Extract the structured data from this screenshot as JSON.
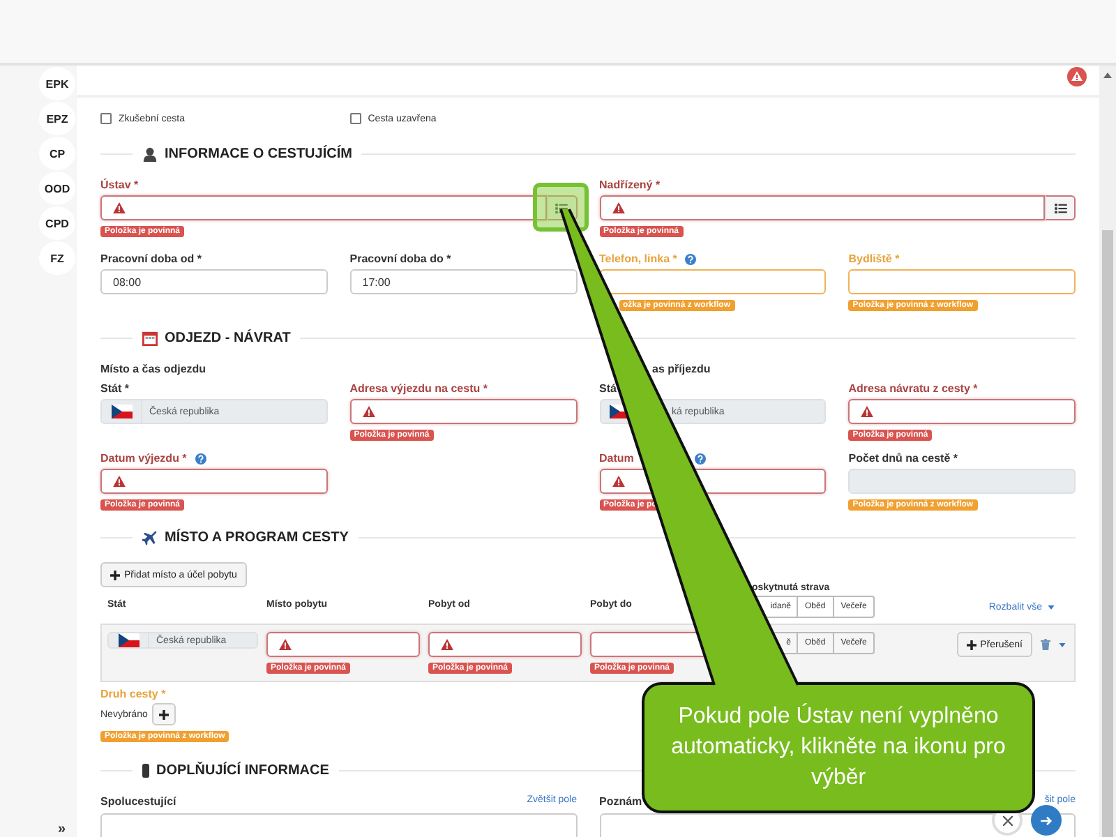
{
  "sidebar": {
    "items": [
      {
        "label": "EPK"
      },
      {
        "label": "EPZ"
      },
      {
        "label": "CP"
      },
      {
        "label": "OOD"
      },
      {
        "label": "CPD"
      },
      {
        "label": "FZ"
      }
    ],
    "collapse": "»"
  },
  "header": {
    "alert": true
  },
  "checkboxes": [
    {
      "label": "Zkušební cesta",
      "checked": false
    },
    {
      "label": "Cesta uzavřena",
      "checked": false
    }
  ],
  "traveler": {
    "title": "INFORMACE O CESTUJÍCÍM",
    "cells": [
      {
        "kind": "field",
        "label": "Ústav *",
        "invalid": true,
        "picker": true,
        "highlighted": true,
        "error": {
          "text": "Položka je povinná",
          "workflow": false
        }
      },
      {
        "kind": "field",
        "label": "Nadřízený *",
        "invalid": true,
        "picker": true,
        "highlighted": false,
        "error": {
          "text": "Položka je povinná",
          "workflow": false
        }
      },
      {
        "kind": "field",
        "label": "Pracovní doba od *",
        "value": "08:00"
      },
      {
        "kind": "field",
        "label": "Pracovní doba do *",
        "value": "17:00"
      },
      {
        "kind": "field",
        "label": "Telefon, linka *",
        "warning": true,
        "help": true,
        "error": {
          "text": "ožka je povinná z workflow",
          "workflow": true,
          "cut": true
        }
      },
      {
        "kind": "field",
        "label": "Bydliště *",
        "warning": true,
        "error": {
          "text": "Položka je povinná z workflow",
          "workflow": true
        }
      }
    ]
  },
  "departure": {
    "title": "ODJEZD - NÁVRAT",
    "cells": [
      {
        "kind": "heading",
        "label": "Místo a čas odjezdu"
      },
      {
        "kind": "heading",
        "label": "as příjezdu",
        "cut": true
      },
      {
        "kind": "country",
        "label": "Stát *",
        "value": "Česká republika"
      },
      {
        "kind": "field",
        "label": "Adresa výjezdu na cestu *",
        "invalid": true,
        "error": {
          "text": "Položka je povinná",
          "workflow": false
        }
      },
      {
        "kind": "country",
        "label": "Stá",
        "value": "ká republika",
        "cut": true
      },
      {
        "kind": "field",
        "label": "Adresa návratu z cesty *",
        "invalid": true,
        "error": {
          "text": "Položka je povinná",
          "workflow": false
        }
      },
      {
        "kind": "field",
        "label": "Datum výjezdu *",
        "invalid": true,
        "help": true,
        "error": {
          "text": "Položka je povinná",
          "workflow": false
        }
      },
      {
        "kind": "empty"
      },
      {
        "kind": "field",
        "label": "Datum",
        "invalid": true,
        "help": true,
        "help_cut": true,
        "error": {
          "text": "Položka je po",
          "workflow": false
        }
      },
      {
        "kind": "field",
        "label": "Počet dnů na cestě *",
        "readonly": true,
        "error": {
          "text": "Položka je povinná z workflow",
          "workflow": true
        }
      }
    ]
  },
  "program": {
    "title": "MÍSTO A PROGRAM CESTY",
    "add_button": "Přidat místo a účel pobytu",
    "columns": [
      "Stát",
      "Místo pobytu",
      "Pobyt od",
      "Pobyt do"
    ],
    "meals_label": "oskytnutá strava",
    "meals_header": [
      "idaně",
      "Oběd",
      "Večeře"
    ],
    "expand": "Rozbalit vše",
    "rows": [
      {
        "country": "Česká republika",
        "fields": [
          {
            "error": "Položka je povinná",
            "alert": true
          },
          {
            "error": "Položka je povinná",
            "alert": true
          },
          {
            "error": "Položka je povinná",
            "alert": false
          }
        ],
        "meals": [
          "ě",
          "Oběd",
          "Večeře"
        ],
        "interrupt": "Přerušení"
      }
    ],
    "trip_type": {
      "label": "Druh cesty *",
      "value": "Nevybráno",
      "error": "Položka je povinná z workflow"
    }
  },
  "extra": {
    "title": "DOPLŇUJÍCÍ INFORMACE",
    "notes": [
      {
        "label": "Spolucestující",
        "link": "Zvětšit pole"
      },
      {
        "label": "Poznám",
        "link": "šit pole"
      }
    ]
  },
  "callout": {
    "text": "Pokud pole Ústav není vyplněno automaticky, klikněte na ikonu pro výběr"
  }
}
